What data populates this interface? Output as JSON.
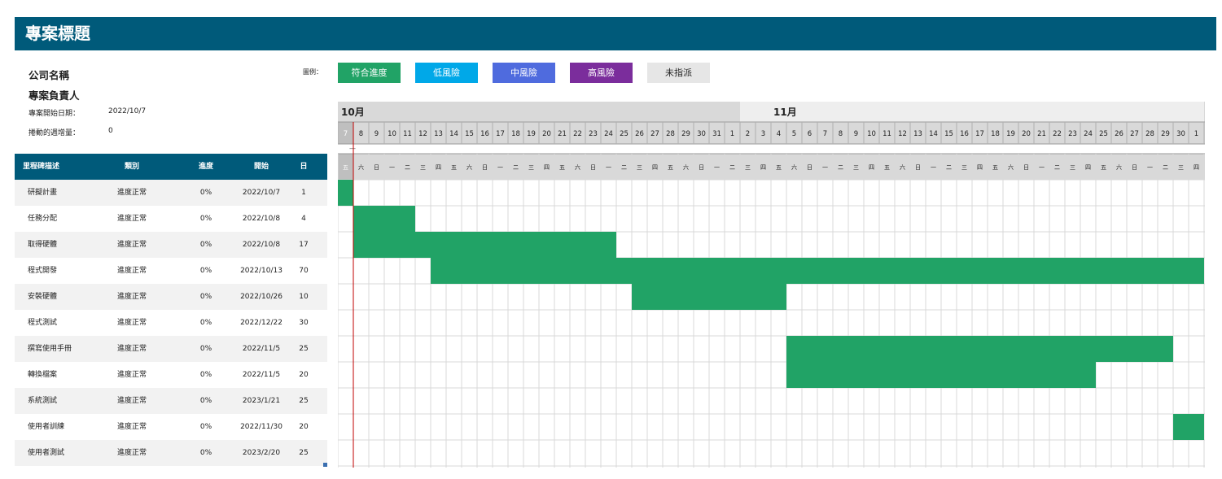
{
  "title": "專案標題",
  "info": {
    "company": "公司名稱",
    "manager": "專案負責人",
    "start_label": "專案開始日期：",
    "start_value": "2022/10/7",
    "week_label": "捲動的週增量：",
    "week_value": "0"
  },
  "legend": {
    "label": "圖例：",
    "items": [
      {
        "label": "符合進度",
        "color": "#21a366",
        "text_color": "#ffffff"
      },
      {
        "label": "低風險",
        "color": "#00a8e8",
        "text_color": "#ffffff"
      },
      {
        "label": "中風險",
        "color": "#4f6bde",
        "text_color": "#ffffff"
      },
      {
        "label": "高風險",
        "color": "#7b2d9c",
        "text_color": "#ffffff"
      },
      {
        "label": "未指派",
        "color": "#e6e6e6",
        "text_color": "#222222"
      }
    ]
  },
  "table": {
    "headers": {
      "name": "里程碑描述",
      "category": "類別",
      "progress": "進度",
      "start": "開始",
      "days": "日"
    },
    "rows": [
      {
        "name": "研擬計畫",
        "category": "進度正常",
        "progress": "0%",
        "start": "2022/10/7",
        "days": "1"
      },
      {
        "name": "任務分配",
        "category": "進度正常",
        "progress": "0%",
        "start": "2022/10/8",
        "days": "4"
      },
      {
        "name": "取得硬體",
        "category": "進度正常",
        "progress": "0%",
        "start": "2022/10/8",
        "days": "17"
      },
      {
        "name": "程式開發",
        "category": "進度正常",
        "progress": "0%",
        "start": "2022/10/13",
        "days": "70"
      },
      {
        "name": "安裝硬體",
        "category": "進度正常",
        "progress": "0%",
        "start": "2022/10/26",
        "days": "10"
      },
      {
        "name": "程式測試",
        "category": "進度正常",
        "progress": "0%",
        "start": "2022/12/22",
        "days": "30"
      },
      {
        "name": "撰寫使用手冊",
        "category": "進度正常",
        "progress": "0%",
        "start": "2022/11/5",
        "days": "25"
      },
      {
        "name": "轉換檔案",
        "category": "進度正常",
        "progress": "0%",
        "start": "2022/11/5",
        "days": "20"
      },
      {
        "name": "系統測試",
        "category": "進度正常",
        "progress": "0%",
        "start": "2023/1/21",
        "days": "25"
      },
      {
        "name": "使用者訓練",
        "category": "進度正常",
        "progress": "0%",
        "start": "2022/11/30",
        "days": "20"
      },
      {
        "name": "使用者測試",
        "category": "進度正常",
        "progress": "0%",
        "start": "2023/2/20",
        "days": "25"
      }
    ]
  },
  "gantt": {
    "months": [
      "10月",
      "11月"
    ],
    "dates": [
      "7",
      "8",
      "9",
      "10",
      "11",
      "12",
      "13",
      "14",
      "15",
      "16",
      "17",
      "18",
      "19",
      "20",
      "21",
      "22",
      "23",
      "24",
      "25",
      "26",
      "27",
      "28",
      "29",
      "30",
      "31",
      "1",
      "2",
      "3",
      "4",
      "5",
      "6",
      "7",
      "8",
      "9",
      "10",
      "11",
      "12",
      "13",
      "14",
      "15",
      "16",
      "17",
      "18",
      "19",
      "20",
      "21",
      "22",
      "23",
      "24",
      "25",
      "26",
      "27",
      "28",
      "29",
      "30",
      "1"
    ],
    "weekdays": [
      "五",
      "六",
      "日",
      "一",
      "二",
      "三",
      "四",
      "五",
      "六",
      "日",
      "一",
      "二",
      "三",
      "四",
      "五",
      "六",
      "日",
      "一",
      "二",
      "三",
      "四",
      "五",
      "六",
      "日",
      "一",
      "二",
      "三",
      "四",
      "五",
      "六",
      "日",
      "一",
      "二",
      "三",
      "四",
      "五",
      "六",
      "日",
      "一",
      "二",
      "三",
      "四",
      "五",
      "六",
      "日",
      "一",
      "二",
      "三",
      "四",
      "五",
      "六",
      "日",
      "一",
      "二",
      "三",
      "四"
    ],
    "dash": "—",
    "bar_color": "#21a366",
    "today_line_color": "#c00000"
  }
}
